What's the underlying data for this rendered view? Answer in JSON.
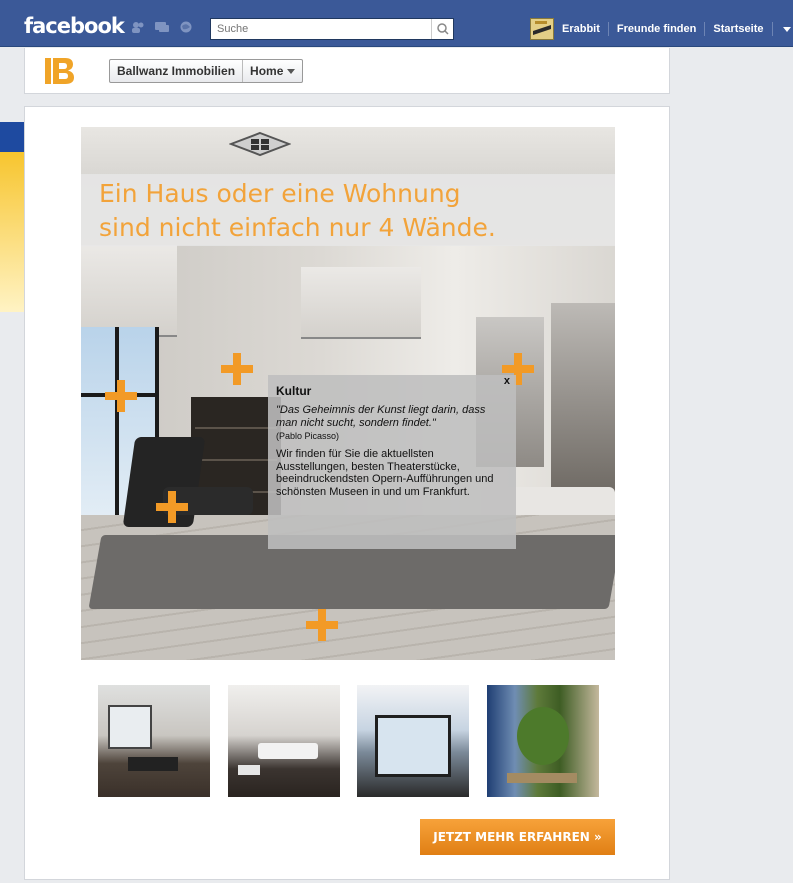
{
  "topbar": {
    "logo": "facebook",
    "search_placeholder": "Suche",
    "nav": [
      "Erabbit",
      "Freunde finden",
      "Startseite"
    ]
  },
  "page": {
    "brand_mark": "IB",
    "name": "Ballwanz Immobilien",
    "tab": "Home"
  },
  "hero": {
    "headline_line1": "Ein Haus oder eine Wohnung",
    "headline_line2": "sind nicht einfach nur 4 Wände."
  },
  "popup": {
    "close": "x",
    "title": "Kultur",
    "quote": "\"Das Geheimnis der Kunst liegt darin, dass man nicht sucht, sondern findet.\"",
    "author": "(Pablo Picasso)",
    "body": "Wir finden für Sie die aktuellsten Ausstellungen, besten Theaterstücke, beeindruckendsten Opern-Aufführungen und schönsten Museen in und um Frankfurt."
  },
  "cta": {
    "label": "JETZT MEHR ERFAHREN »"
  },
  "colors": {
    "fb_blue": "#3b5998",
    "accent_orange": "#f29a26",
    "brand_gold": "#f0a428"
  },
  "icons": [
    "friend-requests-icon",
    "messages-icon",
    "notifications-icon",
    "search-icon",
    "chevron-down-icon",
    "plus-hotspot-icon"
  ]
}
